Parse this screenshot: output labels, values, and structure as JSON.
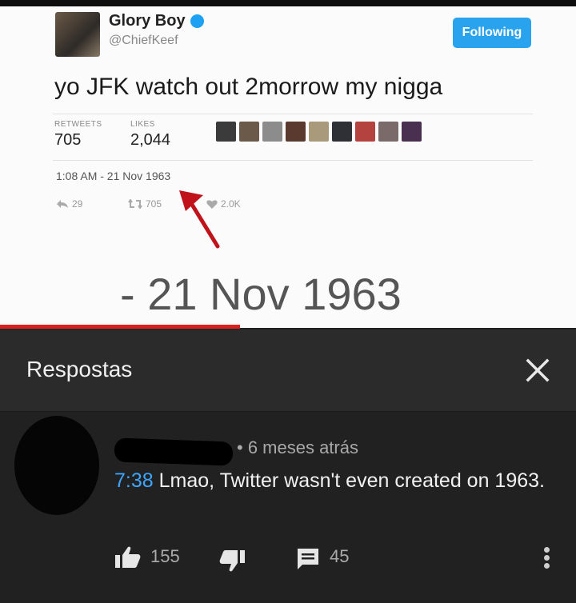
{
  "tweet": {
    "display_name": "Glory Boy",
    "handle": "@ChiefKeef",
    "follow_label": "Following",
    "text": "yo JFK watch out 2morrow my nigga",
    "retweets_label": "RETWEETS",
    "retweets_value": "705",
    "likes_label": "LIKES",
    "likes_value": "2,044",
    "timestamp": "1:08 AM - 21 Nov 1963",
    "reply_count": "29",
    "retweet_count": "705",
    "like_count": "2.0K",
    "zoomed_date": "- 21 Nov 1963"
  },
  "panel": {
    "title": "Respostas",
    "close_icon": "close-icon"
  },
  "comment": {
    "meta": "• 6 meses atrás",
    "timestamp_link": "7:38",
    "text": " Lmao, Twitter wasn't even created on 1963.",
    "like_count": "155",
    "reply_count": "45"
  },
  "colors": {
    "accent": "#3ea6ff",
    "progress": "#d9211f",
    "follow": "#2aa3ef",
    "background": "#212121"
  }
}
